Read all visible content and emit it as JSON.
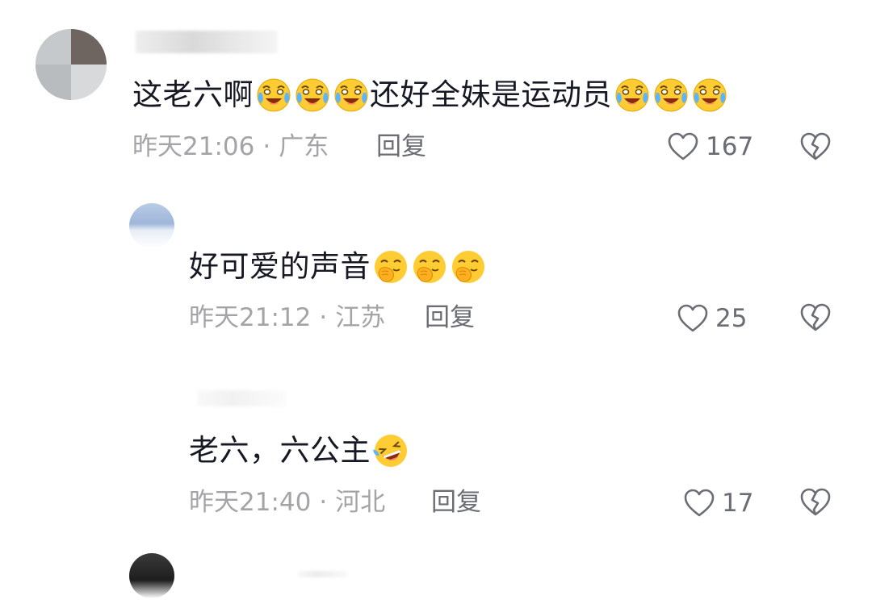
{
  "comments": [
    {
      "text_before": "这老六啊",
      "text_middle": "还好全妹是运动员",
      "emoji_a": "tears-of-joy-emoji",
      "emoji_b": "tears-of-joy-emoji",
      "time": "昨天21:06",
      "location": "广东",
      "reply_label": "回复",
      "likes": "167"
    },
    {
      "text": "好可爱的声音",
      "emoji": "hand-over-mouth-emoji",
      "time": "昨天21:12",
      "location": "江苏",
      "reply_label": "回复",
      "likes": "25"
    },
    {
      "text": "老六，六公主",
      "emoji": "rolling-on-floor-laughing-emoji",
      "time": "昨天21:40",
      "location": "河北",
      "reply_label": "回复",
      "likes": "17"
    }
  ],
  "separator": "·",
  "colors": {
    "text": "#161823",
    "meta": "#a3a4a8",
    "action": "#6b6d74",
    "emoji_face": "#ffcc33"
  }
}
